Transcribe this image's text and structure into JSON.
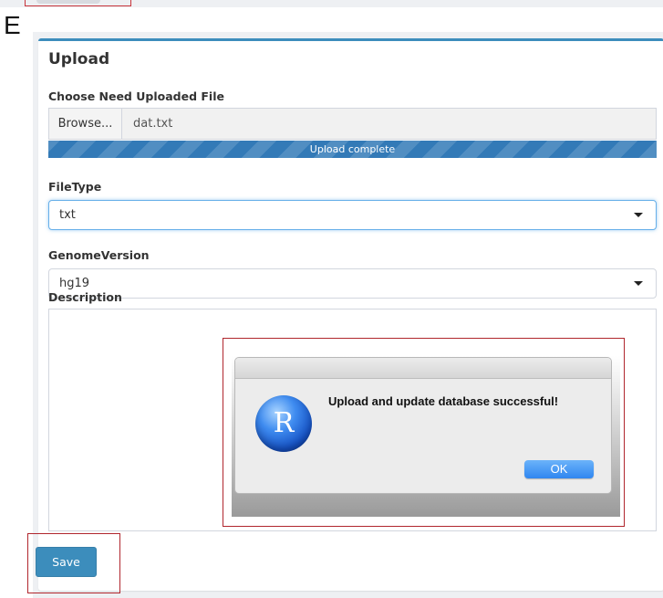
{
  "figure": {
    "panel_letter": "E"
  },
  "card": {
    "title": "Upload",
    "file_label": "Choose Need Uploaded File",
    "browse_label": "Browse...",
    "file_name": "dat.txt",
    "progress_text": "Upload complete",
    "progress_percent": 100,
    "filetype_label": "FileType",
    "filetype_value": "txt",
    "genome_label": "GenomeVersion",
    "genome_value": "hg19",
    "description_label": "Description",
    "save_label": "Save"
  },
  "dialog": {
    "logo_letter": "R",
    "message": "Upload and update database successful!",
    "ok_label": "OK"
  },
  "colors": {
    "accent": "#3c8dbc",
    "progress": "#337ab7",
    "highlight_frame": "#b0262d",
    "dialog_button": "#2f86f0"
  }
}
